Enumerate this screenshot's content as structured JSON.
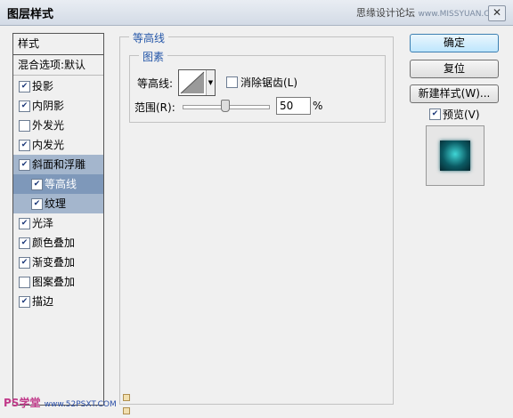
{
  "window": {
    "title": "图层样式",
    "watermark_text": "思缘设计论坛",
    "watermark_url": "www.MISSYUAN.COM",
    "close_symbol": "✕"
  },
  "style_list": {
    "header": "样式",
    "blend_options": "混合选项:默认",
    "items": [
      {
        "label": "投影",
        "checked": true
      },
      {
        "label": "内阴影",
        "checked": true
      },
      {
        "label": "外发光",
        "checked": false
      },
      {
        "label": "内发光",
        "checked": true
      },
      {
        "label": "斜面和浮雕",
        "checked": true
      },
      {
        "label": "等高线",
        "checked": true
      },
      {
        "label": "纹理",
        "checked": true
      },
      {
        "label": "光泽",
        "checked": true
      },
      {
        "label": "颜色叠加",
        "checked": true
      },
      {
        "label": "渐变叠加",
        "checked": true
      },
      {
        "label": "图案叠加",
        "checked": false
      },
      {
        "label": "描边",
        "checked": true
      }
    ]
  },
  "contour_panel": {
    "group_title": "等高线",
    "elements_title": "图素",
    "contour_label": "等高线:",
    "antialias_label": "消除锯齿(L)",
    "antialias_checked": false,
    "range_label": "范围(R):",
    "range_value": "50",
    "range_unit": "%",
    "range_fraction": 0.5
  },
  "buttons": {
    "ok": "确定",
    "reset": "复位",
    "new_style": "新建样式(W)...",
    "preview_label": "预览(V)",
    "preview_checked": true
  },
  "footer_watermark": {
    "brand": "PS学堂",
    "url": "www.52PSXT.COM"
  },
  "colors": {
    "accent_blue": "#2456a8",
    "selected_row": "#7e98ba",
    "sub_row": "#a4b6cd",
    "preview_glow": "#3fd6d6"
  }
}
